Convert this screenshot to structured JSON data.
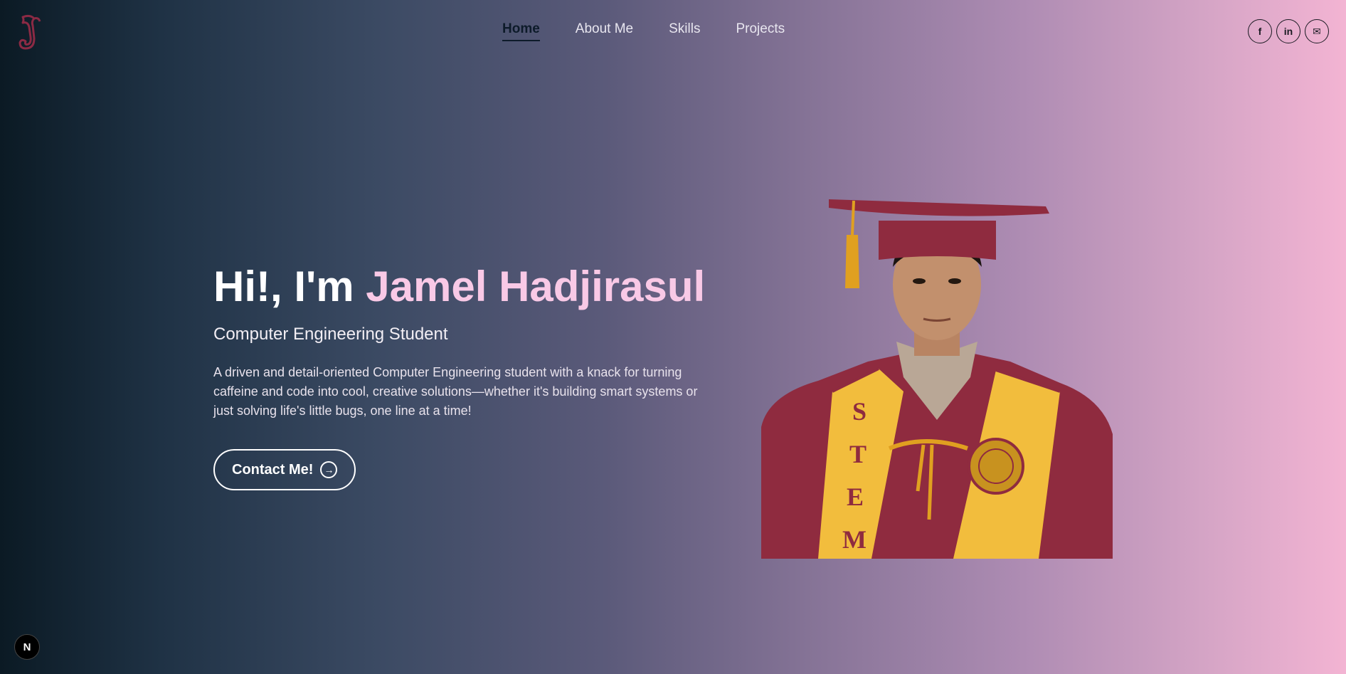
{
  "logo": {
    "icon": "j-logo-icon",
    "color": "#8b2a44"
  },
  "nav": {
    "items": [
      {
        "label": "Home",
        "active": true
      },
      {
        "label": "About Me",
        "active": false
      },
      {
        "label": "Skills",
        "active": false
      },
      {
        "label": "Projects",
        "active": false
      }
    ]
  },
  "socials": [
    {
      "icon": "facebook-icon",
      "glyph": "f"
    },
    {
      "icon": "linkedin-icon",
      "glyph": "in"
    },
    {
      "icon": "mail-icon",
      "glyph": "✉"
    }
  ],
  "hero": {
    "greeting": "Hi!, I'm ",
    "name": "Jamel Hadjirasul",
    "subtitle": "Computer Engineering Student",
    "description": "A driven and detail-oriented Computer Engineering student with a knack for turning caffeine and code into cool, creative solutions—whether it's building smart systems or just solving life's little bugs, one line at a time!",
    "contact_label": "Contact Me!",
    "contact_icon": "arrow-right-circle-icon"
  },
  "portrait": {
    "stole_text": "STEM",
    "gown_color": "#8f2b3f",
    "stole_color": "#f2bd3d"
  },
  "dev_badge": {
    "label": "N",
    "icon": "nextjs-icon"
  },
  "colors": {
    "accent_name": "#f9c9e6",
    "active_nav": "#0d1b2a"
  }
}
